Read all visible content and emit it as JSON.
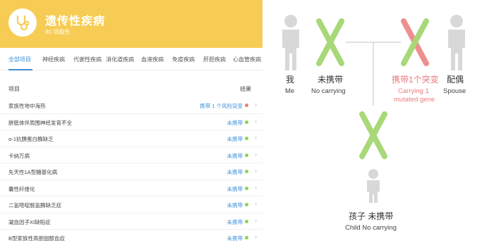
{
  "header": {
    "title": "遗传性疾病",
    "subtitle": "80 项报告",
    "bg_color": "#f6cc55",
    "icon": "stethoscope-icon"
  },
  "tabs": [
    {
      "label": "全部项目",
      "active": true
    },
    {
      "label": "神经疾病",
      "active": false
    },
    {
      "label": "代谢性疾病",
      "active": false
    },
    {
      "label": "消化道疾病",
      "active": false
    },
    {
      "label": "血液疾病",
      "active": false
    },
    {
      "label": "免疫疾病",
      "active": false
    },
    {
      "label": "肝胆疾病",
      "active": false
    },
    {
      "label": "心血管疾病",
      "active": false
    }
  ],
  "table": {
    "col_item": "项目",
    "col_result": "结果",
    "rows": [
      {
        "name": "家族性地中海热",
        "result": "携带 1 个风险突变",
        "status": "risk"
      },
      {
        "name": "胼胝体伴周围神经发育不全",
        "result": "未携带",
        "status": "ok"
      },
      {
        "name": "α-1抗胰蛋白酶缺乏",
        "result": "未携带",
        "status": "ok"
      },
      {
        "name": "卡纳万病",
        "result": "未携带",
        "status": "ok"
      },
      {
        "name": "先天性1A型糖基化病",
        "result": "未携带",
        "status": "ok"
      },
      {
        "name": "囊性纤维化",
        "result": "未携带",
        "status": "ok"
      },
      {
        "name": "二氢嘧啶脱氢酶缺乏症",
        "result": "未携带",
        "status": "ok"
      },
      {
        "name": "凝血因子XI缺陷症",
        "result": "未携带",
        "status": "ok"
      },
      {
        "name": "B型家族性高胆固醇血症",
        "result": "未携带",
        "status": "ok"
      }
    ]
  },
  "colors": {
    "accent": "#3b8fd8",
    "ok_dot": "#8fd14f",
    "risk_dot": "#ec7b7b",
    "chromosome_normal": "#a8d878",
    "chromosome_mutated": "#ee8f8f",
    "person": "#d8d8d8"
  },
  "diagram": {
    "me": {
      "zh": "我",
      "en": "Me"
    },
    "me_chromosome": {
      "zh": "未携带",
      "en": "No carrying"
    },
    "spouse_chromosome": {
      "zh": "携带1个突变",
      "en_line1": "Carrying 1",
      "en_line2": "mutated gene"
    },
    "spouse": {
      "zh": "配偶",
      "en": "Spouse"
    },
    "child": {
      "zh": "孩子 未携带",
      "en": "Child No carrying"
    }
  }
}
